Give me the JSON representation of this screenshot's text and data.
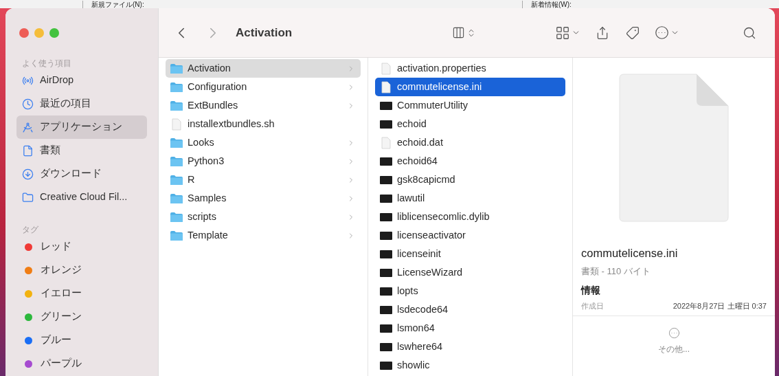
{
  "background_window": {
    "labels": [
      "新規ファイル(N):",
      "新着情報(W):"
    ]
  },
  "window": {
    "title": "Activation"
  },
  "sidebar": {
    "sections": [
      {
        "header": "よく使う項目",
        "items": [
          {
            "label": "AirDrop",
            "kind": "airdrop",
            "selected": false
          },
          {
            "label": "最近の項目",
            "kind": "recent",
            "selected": false
          },
          {
            "label": "アプリケーション",
            "kind": "apps",
            "selected": true
          },
          {
            "label": "書類",
            "kind": "docs",
            "selected": false
          },
          {
            "label": "ダウンロード",
            "kind": "download",
            "selected": false
          },
          {
            "label": "Creative Cloud Fil...",
            "kind": "folder",
            "selected": false
          }
        ]
      },
      {
        "header": "タグ",
        "items": [
          {
            "label": "レッド",
            "kind": "tag",
            "color": "#f03a36",
            "selected": false
          },
          {
            "label": "オレンジ",
            "kind": "tag",
            "color": "#f07d14",
            "selected": false
          },
          {
            "label": "イエロー",
            "kind": "tag",
            "color": "#f2b210",
            "selected": false
          },
          {
            "label": "グリーン",
            "kind": "tag",
            "color": "#2db83d",
            "selected": false
          },
          {
            "label": "ブルー",
            "kind": "tag",
            "color": "#1a6ef5",
            "selected": false
          },
          {
            "label": "パープル",
            "kind": "tag",
            "color": "#a64bd0",
            "selected": false
          }
        ]
      }
    ]
  },
  "columns": [
    {
      "active": false,
      "items": [
        {
          "name": "Activation",
          "kind": "folder",
          "selected": true
        },
        {
          "name": "Configuration",
          "kind": "folder",
          "selected": false
        },
        {
          "name": "ExtBundles",
          "kind": "folder",
          "selected": false
        },
        {
          "name": "installextbundles.sh",
          "kind": "file",
          "selected": false
        },
        {
          "name": "Looks",
          "kind": "folder",
          "selected": false
        },
        {
          "name": "Python3",
          "kind": "folder",
          "selected": false
        },
        {
          "name": "R",
          "kind": "folder",
          "selected": false
        },
        {
          "name": "Samples",
          "kind": "folder",
          "selected": false
        },
        {
          "name": "scripts",
          "kind": "folder",
          "selected": false
        },
        {
          "name": "Template",
          "kind": "folder",
          "selected": false
        }
      ]
    },
    {
      "active": true,
      "items": [
        {
          "name": "activation.properties",
          "kind": "file",
          "selected": false
        },
        {
          "name": "commutelicense.ini",
          "kind": "file",
          "selected": true
        },
        {
          "name": "CommuterUtility",
          "kind": "exec",
          "selected": false
        },
        {
          "name": "echoid",
          "kind": "exec",
          "selected": false
        },
        {
          "name": "echoid.dat",
          "kind": "file",
          "selected": false
        },
        {
          "name": "echoid64",
          "kind": "exec",
          "selected": false
        },
        {
          "name": "gsk8capicmd",
          "kind": "exec",
          "selected": false
        },
        {
          "name": "lawutil",
          "kind": "exec",
          "selected": false
        },
        {
          "name": "liblicensecomlic.dylib",
          "kind": "exec",
          "selected": false
        },
        {
          "name": "licenseactivator",
          "kind": "exec",
          "selected": false
        },
        {
          "name": "licenseinit",
          "kind": "exec",
          "selected": false
        },
        {
          "name": "LicenseWizard",
          "kind": "exec",
          "selected": false
        },
        {
          "name": "lopts",
          "kind": "exec",
          "selected": false
        },
        {
          "name": "lsdecode64",
          "kind": "exec",
          "selected": false
        },
        {
          "name": "lsmon64",
          "kind": "exec",
          "selected": false
        },
        {
          "name": "lswhere64",
          "kind": "exec",
          "selected": false
        },
        {
          "name": "showlic",
          "kind": "exec",
          "selected": false
        }
      ]
    }
  ],
  "preview": {
    "name": "commutelicense.ini",
    "subtitle": "書類 - 110 バイト",
    "section": "情報",
    "fields": [
      {
        "label": "作成日",
        "value": "2022年8月27日 土曜日 0:37"
      }
    ],
    "more": "その他..."
  }
}
